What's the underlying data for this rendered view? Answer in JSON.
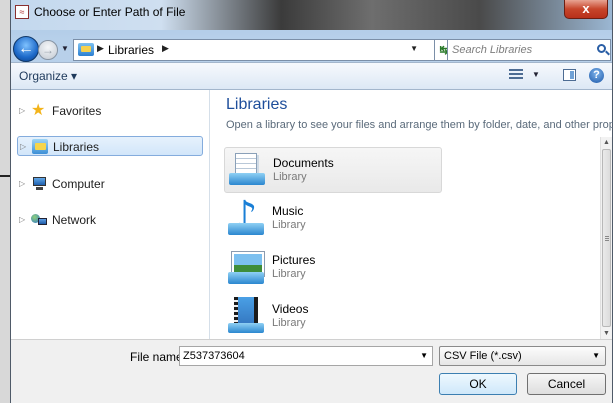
{
  "window": {
    "title": "Choose or Enter Path of File",
    "close_glyph": "x"
  },
  "navigation": {
    "back_glyph": "←",
    "forward_glyph": "→",
    "address_crumb": "Libraries",
    "search_placeholder": "Search Libraries"
  },
  "toolbar": {
    "organize_label": "Organize ▾",
    "help_glyph": "?"
  },
  "sidebar": {
    "items": [
      {
        "label": "Favorites",
        "icon": "star-icon"
      },
      {
        "label": "Libraries",
        "icon": "libraries-icon",
        "selected": true
      },
      {
        "label": "Computer",
        "icon": "computer-icon"
      },
      {
        "label": "Network",
        "icon": "network-icon"
      }
    ]
  },
  "main": {
    "title": "Libraries",
    "subtitle": "Open a library to see your files and arrange them by folder, date, and other prop...",
    "libraries": [
      {
        "name": "Documents",
        "type": "Library",
        "icon": "documents-icon"
      },
      {
        "name": "Music",
        "type": "Library",
        "icon": "music-icon"
      },
      {
        "name": "Pictures",
        "type": "Library",
        "icon": "pictures-icon"
      },
      {
        "name": "Videos",
        "type": "Library",
        "icon": "videos-icon"
      }
    ]
  },
  "footer": {
    "file_name_label": "File name:",
    "file_name_value": "Z537373604",
    "file_type_value": "CSV File (*.csv)",
    "ok_label": "OK",
    "cancel_label": "Cancel"
  },
  "colors": {
    "title_accent": "#1e4e9b",
    "selection_border": "#84acdd",
    "close_red": "#c7452b"
  }
}
